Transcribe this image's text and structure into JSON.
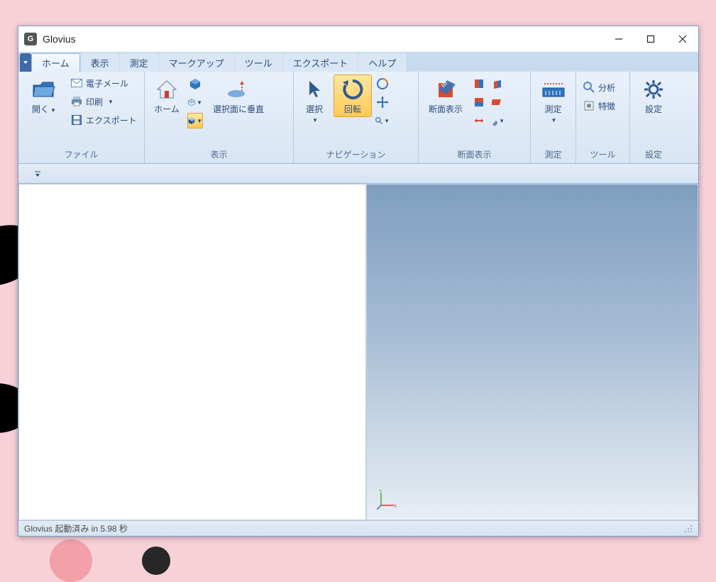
{
  "app": {
    "title": "Glovius",
    "icon_letter": "G"
  },
  "tabs": {
    "active": "ホーム",
    "items": [
      "ホーム",
      "表示",
      "測定",
      "マークアップ",
      "ツール",
      "エクスポート",
      "ヘルプ"
    ]
  },
  "ribbon": {
    "file": {
      "label": "ファイル",
      "open": "開く",
      "email": "電子メール",
      "print": "印刷",
      "export": "エクスポート"
    },
    "display": {
      "label": "表示",
      "home": "ホーム",
      "perp": "選択面に垂直"
    },
    "nav": {
      "label": "ナビゲーション",
      "select": "選択",
      "rotate": "回転"
    },
    "section": {
      "label": "断面表示",
      "section": "断面表示"
    },
    "measure": {
      "label": "測定",
      "measure": "測定"
    },
    "tools": {
      "label": "ツール",
      "analysis": "分析",
      "feature": "特徴"
    },
    "settings": {
      "label": "設定",
      "settings": "設定"
    }
  },
  "status": {
    "text": "Glovius 起動済み in 5.98 秒"
  }
}
